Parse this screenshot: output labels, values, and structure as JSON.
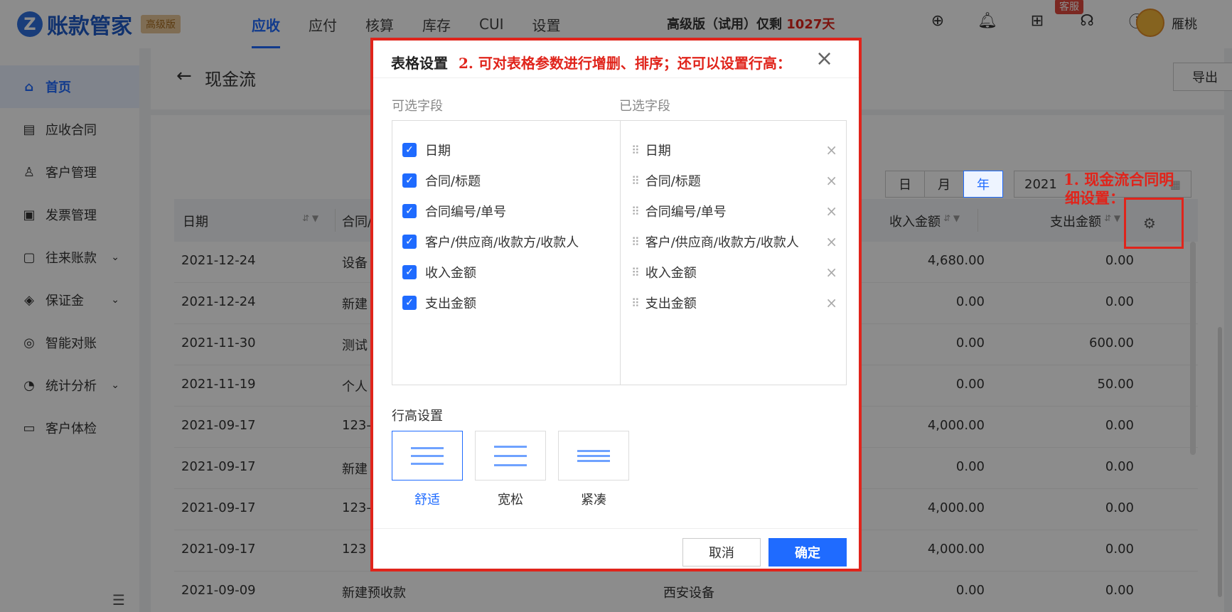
{
  "app": {
    "logo_letter": "Z",
    "name": "账款管家",
    "edition_badge": "高级版",
    "trial_prefix": "高级版（试用）仅剩 ",
    "trial_days": "1027天",
    "kefu": "客服",
    "username": "雁桃"
  },
  "nav": [
    "应收",
    "应付",
    "核算",
    "库存",
    "CUI",
    "设置"
  ],
  "sidebar": [
    {
      "label": "首页",
      "icon": "home-icon",
      "glyph": "⌂"
    },
    {
      "label": "应收合同",
      "icon": "contract-icon",
      "glyph": "▤"
    },
    {
      "label": "客户管理",
      "icon": "user-icon",
      "glyph": "♙"
    },
    {
      "label": "发票管理",
      "icon": "invoice-icon",
      "glyph": "▣"
    },
    {
      "label": "往来账款",
      "icon": "ledger-icon",
      "glyph": "▢"
    },
    {
      "label": "保证金",
      "icon": "shield-icon",
      "glyph": "◈"
    },
    {
      "label": "智能对账",
      "icon": "reconcile-icon",
      "glyph": "◎"
    },
    {
      "label": "统计分析",
      "icon": "pie-chart-icon",
      "glyph": "◔"
    },
    {
      "label": "客户体检",
      "icon": "monitor-icon",
      "glyph": "▭"
    }
  ],
  "page": {
    "title": "现金流",
    "export": "导出",
    "periods": [
      "日",
      "月",
      "年"
    ],
    "year": "2021"
  },
  "table": {
    "headers": {
      "date": "日期",
      "contract": "合同/",
      "income": "收入金额",
      "expense": "支出金额"
    },
    "rows": [
      {
        "date": "2021-12-24",
        "contract": "设备",
        "party": "",
        "income": "4,680.00",
        "expense": "0.00"
      },
      {
        "date": "2021-12-24",
        "contract": "新建",
        "party": "",
        "income": "0.00",
        "expense": "0.00"
      },
      {
        "date": "2021-11-30",
        "contract": "测试",
        "party": "",
        "income": "0.00",
        "expense": "600.00"
      },
      {
        "date": "2021-11-19",
        "contract": "个人",
        "party": "",
        "income": "0.00",
        "expense": "50.00"
      },
      {
        "date": "2021-09-17",
        "contract": "123-",
        "party": "",
        "income": "4,000.00",
        "expense": "0.00"
      },
      {
        "date": "2021-09-17",
        "contract": "新建",
        "party": "",
        "income": "0.00",
        "expense": "0.00"
      },
      {
        "date": "2021-09-17",
        "contract": "123-",
        "party": "",
        "income": "4,000.00",
        "expense": "0.00"
      },
      {
        "date": "2021-09-17",
        "contract": "123",
        "party": "",
        "income": "4,000.00",
        "expense": "0.00"
      },
      {
        "date": "2021-09-09",
        "contract": "新建预收款",
        "party": "西安设备",
        "income": "0.00",
        "expense": "0.00"
      }
    ]
  },
  "annotations": {
    "right": [
      "1. 现金流合同明",
      "细设置："
    ],
    "modal": "2. 可对表格参数进行增删、排序；还可以设置行高："
  },
  "modal": {
    "title": "表格设置",
    "available_label": "可选字段",
    "selected_label": "已选字段",
    "fields": [
      "日期",
      "合同/标题",
      "合同编号/单号",
      "客户/供应商/收款方/收款人",
      "收入金额",
      "支出金额"
    ],
    "row_height_label": "行高设置",
    "row_heights": [
      "舒适",
      "宽松",
      "紧凑"
    ],
    "cancel": "取消",
    "confirm": "确定"
  }
}
